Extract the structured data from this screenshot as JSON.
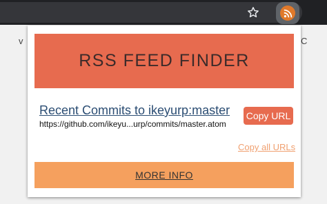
{
  "browser": {
    "star_icon": "star-icon",
    "extension_icon": "rss-icon",
    "background_text_left": "v",
    "background_text_right": "C"
  },
  "popup": {
    "title": "RSS FEED FINDER",
    "feeds": [
      {
        "title": "Recent Commits to ikeyurp:master",
        "url": "https://github.com/ikeyu...urp/commits/master.atom",
        "copy_label": "Copy URL"
      }
    ],
    "copy_all_label": "Copy all URLs",
    "more_info_label": "MORE INFO"
  },
  "colors": {
    "header": "#e76b4f",
    "footer": "#f5a05e",
    "copy_button": "#e76b4f",
    "link": "#2b4d73",
    "rss_badge": "#e0792a"
  }
}
